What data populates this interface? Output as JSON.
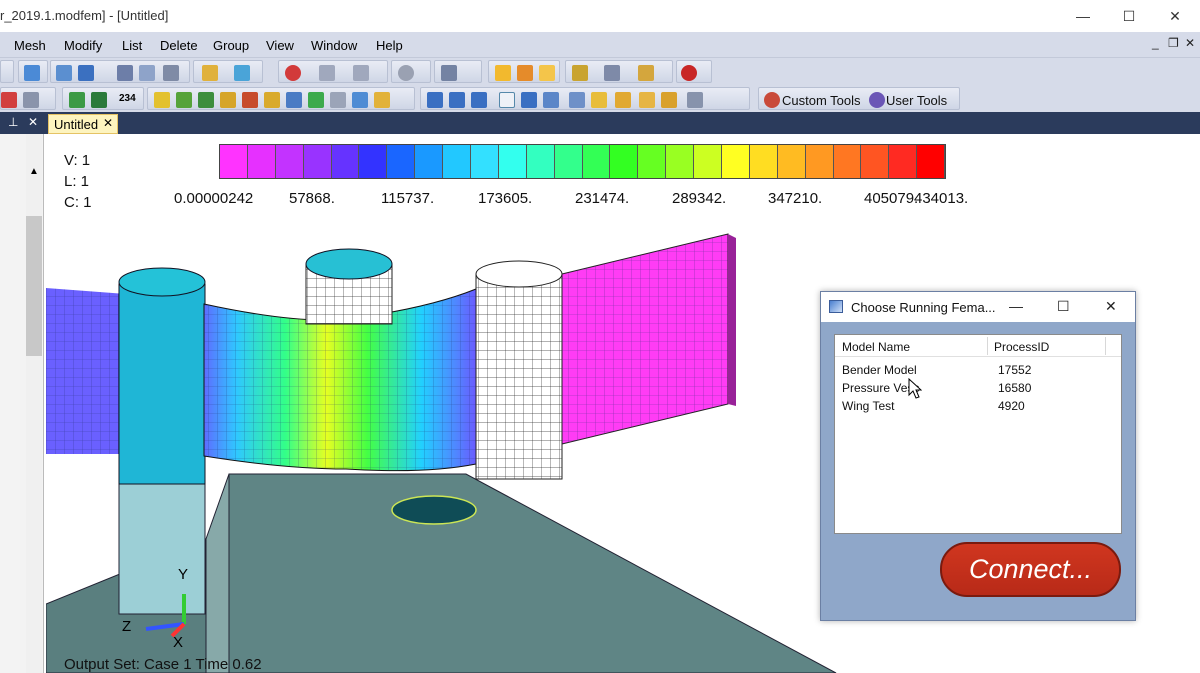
{
  "window": {
    "title": "r_2019.1.modfem] - [Untitled]",
    "minimize": "—",
    "maximize": "☐",
    "close": "✕"
  },
  "menu": {
    "items": [
      "Mesh",
      "Modify",
      "List",
      "Delete",
      "Group",
      "View",
      "Window",
      "Help"
    ],
    "right_controls": [
      "_",
      "❐",
      "✕"
    ]
  },
  "toolbar": {
    "custom_tools": "Custom Tools",
    "user_tools": "User Tools",
    "numeric_icon": "234"
  },
  "tabs": {
    "active": "Untitled",
    "close": "✕",
    "pin": "⊥",
    "pane_close": "✕"
  },
  "viewport": {
    "view_info": [
      "V: 1",
      "L: 1",
      "C: 1"
    ],
    "legend_values": [
      "0.00000242",
      "57868.",
      "115737.",
      "173605.",
      "231474.",
      "289342.",
      "347210.",
      "405079.",
      "434013."
    ],
    "legend_colors": [
      "#ff33ff",
      "#e630ff",
      "#c333ff",
      "#9933ff",
      "#6633ff",
      "#3333ff",
      "#1a66ff",
      "#1a99ff",
      "#22c8ff",
      "#33e0ff",
      "#33ffee",
      "#33ffc0",
      "#33ff8c",
      "#33ff55",
      "#33ff22",
      "#66ff22",
      "#99ff22",
      "#ccff22",
      "#ffff22",
      "#ffdd22",
      "#ffbb22",
      "#ff9922",
      "#ff7722",
      "#ff5522",
      "#ff2a22",
      "#ff0000"
    ],
    "axis_labels": {
      "y": "Y",
      "z": "Z",
      "x": "X"
    },
    "output_set": "Output Set: Case 1 Time 0.62"
  },
  "dialog": {
    "title": "Choose Running Fema...",
    "minimize": "—",
    "maximize": "☐",
    "close": "✕",
    "columns": [
      "Model Name",
      "ProcessID"
    ],
    "rows": [
      {
        "name": "Bender Model",
        "pid": "17552"
      },
      {
        "name": "Pressure Vess",
        "pid": "16580"
      },
      {
        "name": "Wing Test",
        "pid": "4920"
      }
    ],
    "connect": "Connect..."
  }
}
